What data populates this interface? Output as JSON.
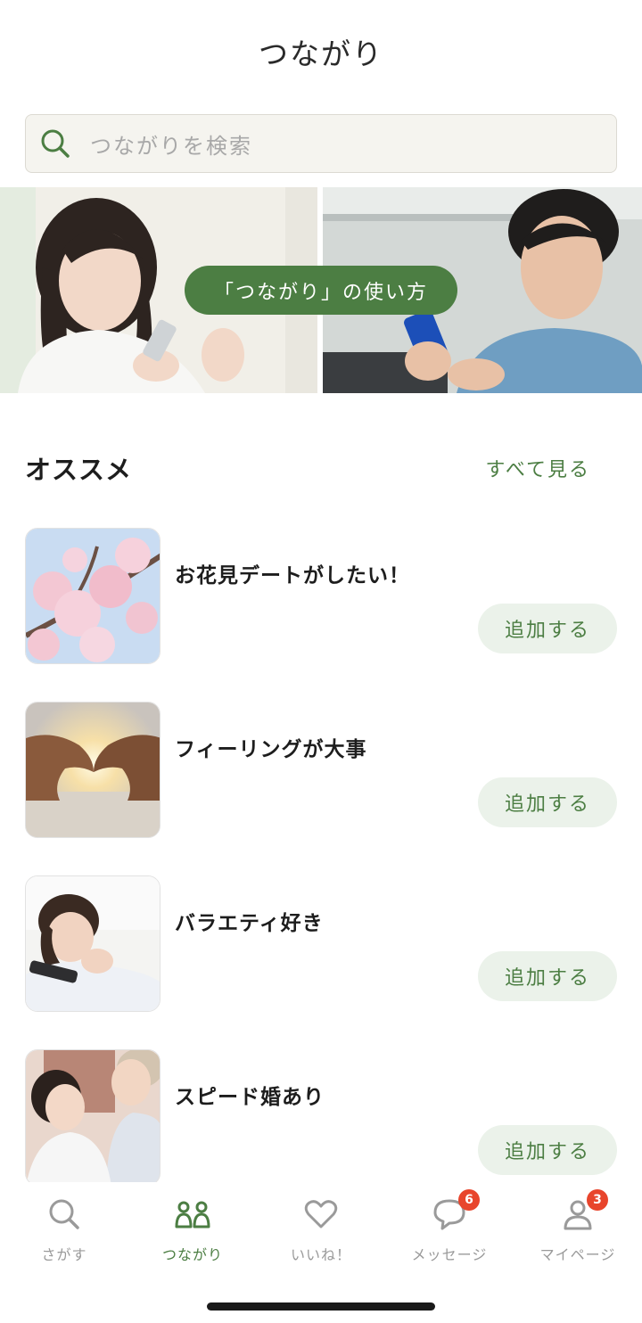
{
  "header": {
    "title": "つながり"
  },
  "search": {
    "placeholder": "つながりを検索"
  },
  "banner": {
    "pill_label": "「つながり」の使い方"
  },
  "recommend": {
    "title": "オススメ",
    "see_all": "すべて見る",
    "items": [
      {
        "title": "お花見デートがしたい！",
        "button": "追加する",
        "thumb": "cherry-blossom-photo"
      },
      {
        "title": "フィーリングが大事",
        "button": "追加する",
        "thumb": "heart-hands-photo"
      },
      {
        "title": "バラエティ好き",
        "button": "追加する",
        "thumb": "smiling-woman-photo"
      },
      {
        "title": "スピード婚あり",
        "button": "追加する",
        "thumb": "wedding-couple-photo"
      }
    ]
  },
  "tabbar": {
    "tabs": [
      {
        "label": "さがす",
        "icon": "search-icon"
      },
      {
        "label": "つながり",
        "icon": "people-icon",
        "active": true
      },
      {
        "label": "いいね！",
        "icon": "heart-icon"
      },
      {
        "label": "メッセージ",
        "icon": "chat-icon",
        "badge": "6"
      },
      {
        "label": "マイページ",
        "icon": "user-icon",
        "badge": "3"
      }
    ]
  },
  "colors": {
    "accent": "#4c7e43",
    "badge": "#e8452c",
    "accent_light": "#ebf2ea"
  }
}
